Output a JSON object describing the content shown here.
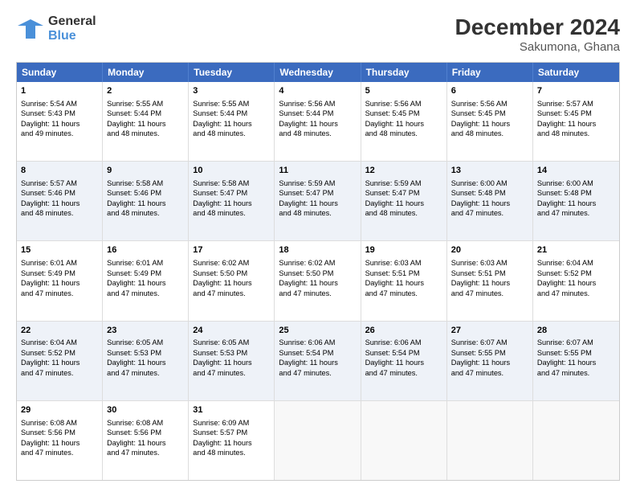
{
  "header": {
    "logo_general": "General",
    "logo_blue": "Blue",
    "title": "December 2024",
    "subtitle": "Sakumona, Ghana"
  },
  "weekdays": [
    "Sunday",
    "Monday",
    "Tuesday",
    "Wednesday",
    "Thursday",
    "Friday",
    "Saturday"
  ],
  "weeks": [
    [
      {
        "day": "1",
        "lines": [
          "Sunrise: 5:54 AM",
          "Sunset: 5:43 PM",
          "Daylight: 11 hours",
          "and 49 minutes."
        ]
      },
      {
        "day": "2",
        "lines": [
          "Sunrise: 5:55 AM",
          "Sunset: 5:44 PM",
          "Daylight: 11 hours",
          "and 48 minutes."
        ]
      },
      {
        "day": "3",
        "lines": [
          "Sunrise: 5:55 AM",
          "Sunset: 5:44 PM",
          "Daylight: 11 hours",
          "and 48 minutes."
        ]
      },
      {
        "day": "4",
        "lines": [
          "Sunrise: 5:56 AM",
          "Sunset: 5:44 PM",
          "Daylight: 11 hours",
          "and 48 minutes."
        ]
      },
      {
        "day": "5",
        "lines": [
          "Sunrise: 5:56 AM",
          "Sunset: 5:45 PM",
          "Daylight: 11 hours",
          "and 48 minutes."
        ]
      },
      {
        "day": "6",
        "lines": [
          "Sunrise: 5:56 AM",
          "Sunset: 5:45 PM",
          "Daylight: 11 hours",
          "and 48 minutes."
        ]
      },
      {
        "day": "7",
        "lines": [
          "Sunrise: 5:57 AM",
          "Sunset: 5:45 PM",
          "Daylight: 11 hours",
          "and 48 minutes."
        ]
      }
    ],
    [
      {
        "day": "8",
        "lines": [
          "Sunrise: 5:57 AM",
          "Sunset: 5:46 PM",
          "Daylight: 11 hours",
          "and 48 minutes."
        ]
      },
      {
        "day": "9",
        "lines": [
          "Sunrise: 5:58 AM",
          "Sunset: 5:46 PM",
          "Daylight: 11 hours",
          "and 48 minutes."
        ]
      },
      {
        "day": "10",
        "lines": [
          "Sunrise: 5:58 AM",
          "Sunset: 5:47 PM",
          "Daylight: 11 hours",
          "and 48 minutes."
        ]
      },
      {
        "day": "11",
        "lines": [
          "Sunrise: 5:59 AM",
          "Sunset: 5:47 PM",
          "Daylight: 11 hours",
          "and 48 minutes."
        ]
      },
      {
        "day": "12",
        "lines": [
          "Sunrise: 5:59 AM",
          "Sunset: 5:47 PM",
          "Daylight: 11 hours",
          "and 48 minutes."
        ]
      },
      {
        "day": "13",
        "lines": [
          "Sunrise: 6:00 AM",
          "Sunset: 5:48 PM",
          "Daylight: 11 hours",
          "and 47 minutes."
        ]
      },
      {
        "day": "14",
        "lines": [
          "Sunrise: 6:00 AM",
          "Sunset: 5:48 PM",
          "Daylight: 11 hours",
          "and 47 minutes."
        ]
      }
    ],
    [
      {
        "day": "15",
        "lines": [
          "Sunrise: 6:01 AM",
          "Sunset: 5:49 PM",
          "Daylight: 11 hours",
          "and 47 minutes."
        ]
      },
      {
        "day": "16",
        "lines": [
          "Sunrise: 6:01 AM",
          "Sunset: 5:49 PM",
          "Daylight: 11 hours",
          "and 47 minutes."
        ]
      },
      {
        "day": "17",
        "lines": [
          "Sunrise: 6:02 AM",
          "Sunset: 5:50 PM",
          "Daylight: 11 hours",
          "and 47 minutes."
        ]
      },
      {
        "day": "18",
        "lines": [
          "Sunrise: 6:02 AM",
          "Sunset: 5:50 PM",
          "Daylight: 11 hours",
          "and 47 minutes."
        ]
      },
      {
        "day": "19",
        "lines": [
          "Sunrise: 6:03 AM",
          "Sunset: 5:51 PM",
          "Daylight: 11 hours",
          "and 47 minutes."
        ]
      },
      {
        "day": "20",
        "lines": [
          "Sunrise: 6:03 AM",
          "Sunset: 5:51 PM",
          "Daylight: 11 hours",
          "and 47 minutes."
        ]
      },
      {
        "day": "21",
        "lines": [
          "Sunrise: 6:04 AM",
          "Sunset: 5:52 PM",
          "Daylight: 11 hours",
          "and 47 minutes."
        ]
      }
    ],
    [
      {
        "day": "22",
        "lines": [
          "Sunrise: 6:04 AM",
          "Sunset: 5:52 PM",
          "Daylight: 11 hours",
          "and 47 minutes."
        ]
      },
      {
        "day": "23",
        "lines": [
          "Sunrise: 6:05 AM",
          "Sunset: 5:53 PM",
          "Daylight: 11 hours",
          "and 47 minutes."
        ]
      },
      {
        "day": "24",
        "lines": [
          "Sunrise: 6:05 AM",
          "Sunset: 5:53 PM",
          "Daylight: 11 hours",
          "and 47 minutes."
        ]
      },
      {
        "day": "25",
        "lines": [
          "Sunrise: 6:06 AM",
          "Sunset: 5:54 PM",
          "Daylight: 11 hours",
          "and 47 minutes."
        ]
      },
      {
        "day": "26",
        "lines": [
          "Sunrise: 6:06 AM",
          "Sunset: 5:54 PM",
          "Daylight: 11 hours",
          "and 47 minutes."
        ]
      },
      {
        "day": "27",
        "lines": [
          "Sunrise: 6:07 AM",
          "Sunset: 5:55 PM",
          "Daylight: 11 hours",
          "and 47 minutes."
        ]
      },
      {
        "day": "28",
        "lines": [
          "Sunrise: 6:07 AM",
          "Sunset: 5:55 PM",
          "Daylight: 11 hours",
          "and 47 minutes."
        ]
      }
    ],
    [
      {
        "day": "29",
        "lines": [
          "Sunrise: 6:08 AM",
          "Sunset: 5:56 PM",
          "Daylight: 11 hours",
          "and 47 minutes."
        ]
      },
      {
        "day": "30",
        "lines": [
          "Sunrise: 6:08 AM",
          "Sunset: 5:56 PM",
          "Daylight: 11 hours",
          "and 47 minutes."
        ]
      },
      {
        "day": "31",
        "lines": [
          "Sunrise: 6:09 AM",
          "Sunset: 5:57 PM",
          "Daylight: 11 hours",
          "and 48 minutes."
        ]
      },
      {
        "day": "",
        "lines": []
      },
      {
        "day": "",
        "lines": []
      },
      {
        "day": "",
        "lines": []
      },
      {
        "day": "",
        "lines": []
      }
    ]
  ]
}
